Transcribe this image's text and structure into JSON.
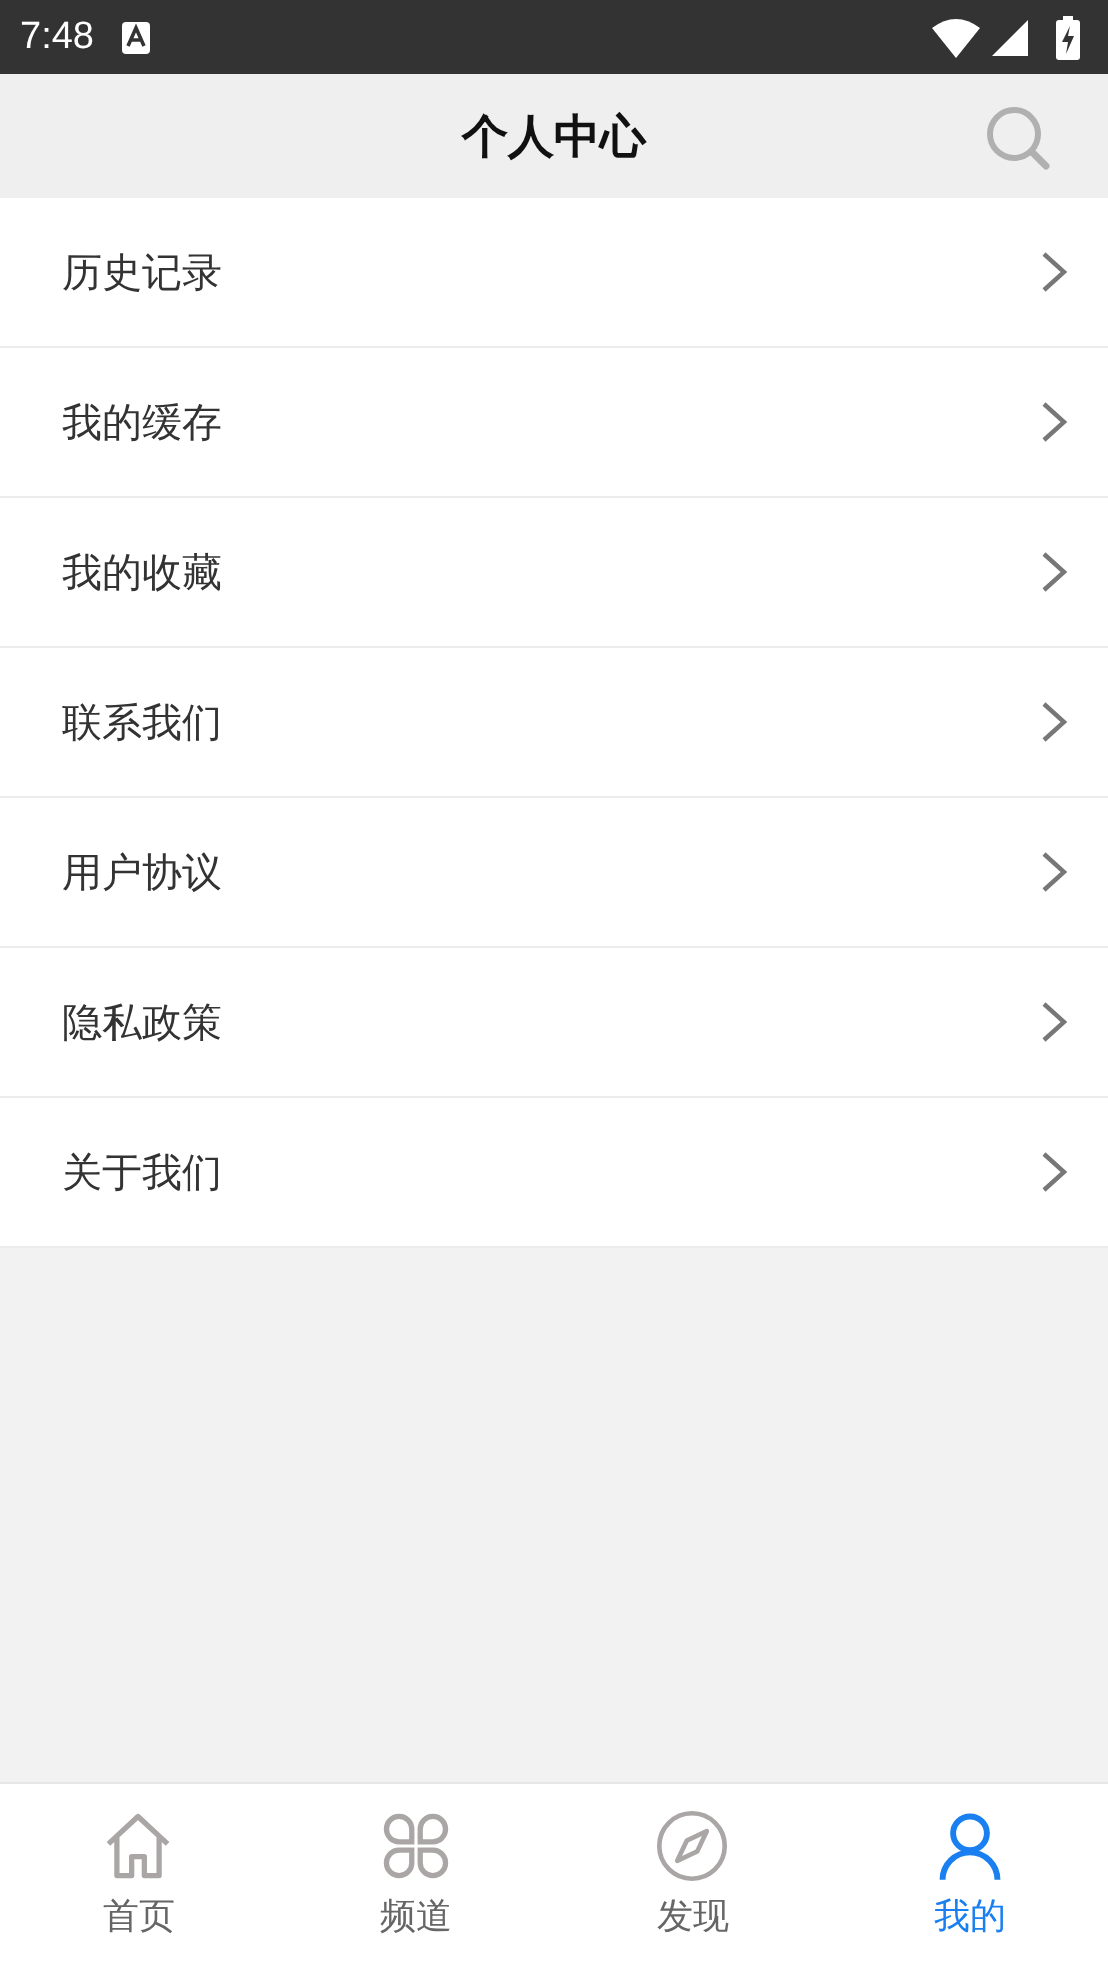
{
  "status_bar": {
    "time": "7:48"
  },
  "header": {
    "title": "个人中心"
  },
  "menu_items": [
    {
      "label": "历史记录"
    },
    {
      "label": "我的缓存"
    },
    {
      "label": "我的收藏"
    },
    {
      "label": "联系我们"
    },
    {
      "label": "用户协议"
    },
    {
      "label": "隐私政策"
    },
    {
      "label": "关于我们"
    }
  ],
  "tab_bar": [
    {
      "label": "首页",
      "kind": "home",
      "selected": false
    },
    {
      "label": "频道",
      "kind": "channels",
      "selected": false
    },
    {
      "label": "发现",
      "kind": "discover",
      "selected": false
    },
    {
      "label": "我的",
      "kind": "profile",
      "selected": true
    }
  ]
}
